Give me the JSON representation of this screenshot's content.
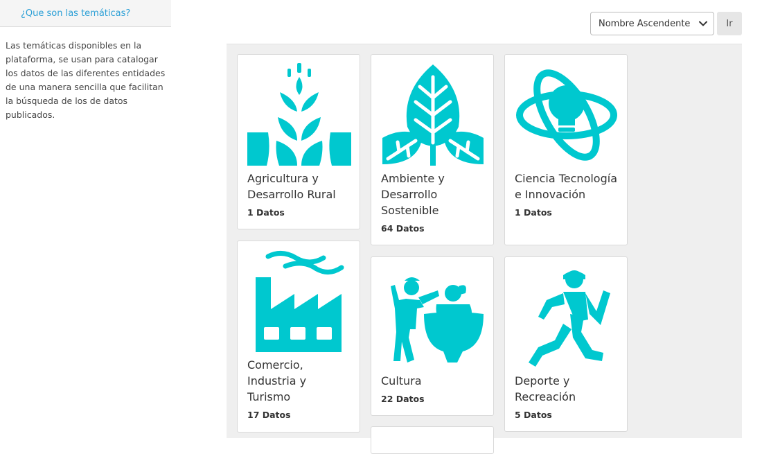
{
  "sidebar": {
    "heading": "¿Que son las temáticas?",
    "description": "Las temáticas disponibles en la plataforma, se usan para catalogar los datos de las diferentes entidades de una manera sencilla que facilitan la búsqueda de los de datos publicados."
  },
  "sort": {
    "selected": "Nombre Ascendente",
    "go_label": "Ir"
  },
  "colors": {
    "accent": "#00c8cf",
    "link": "#2a9fd6"
  },
  "cards": [
    {
      "title": "Agricultura y Desarrollo Rural",
      "count": "1 Datos",
      "icon": "wheat-icon"
    },
    {
      "title": "Ambiente y Desarrollo Sostenible",
      "count": "64 Datos",
      "icon": "leaf-icon"
    },
    {
      "title": "Ciencia Tecnología e Innovación",
      "count": "1 Datos",
      "icon": "atom-bulb-icon"
    },
    {
      "title": "Comercio, Industria y Turismo",
      "count": "17 Datos",
      "icon": "factory-icon"
    },
    {
      "title": "Cultura",
      "count": "22 Datos",
      "icon": "dancers-icon"
    },
    {
      "title": "Deporte y Recreación",
      "count": "5 Datos",
      "icon": "runner-icon"
    }
  ]
}
